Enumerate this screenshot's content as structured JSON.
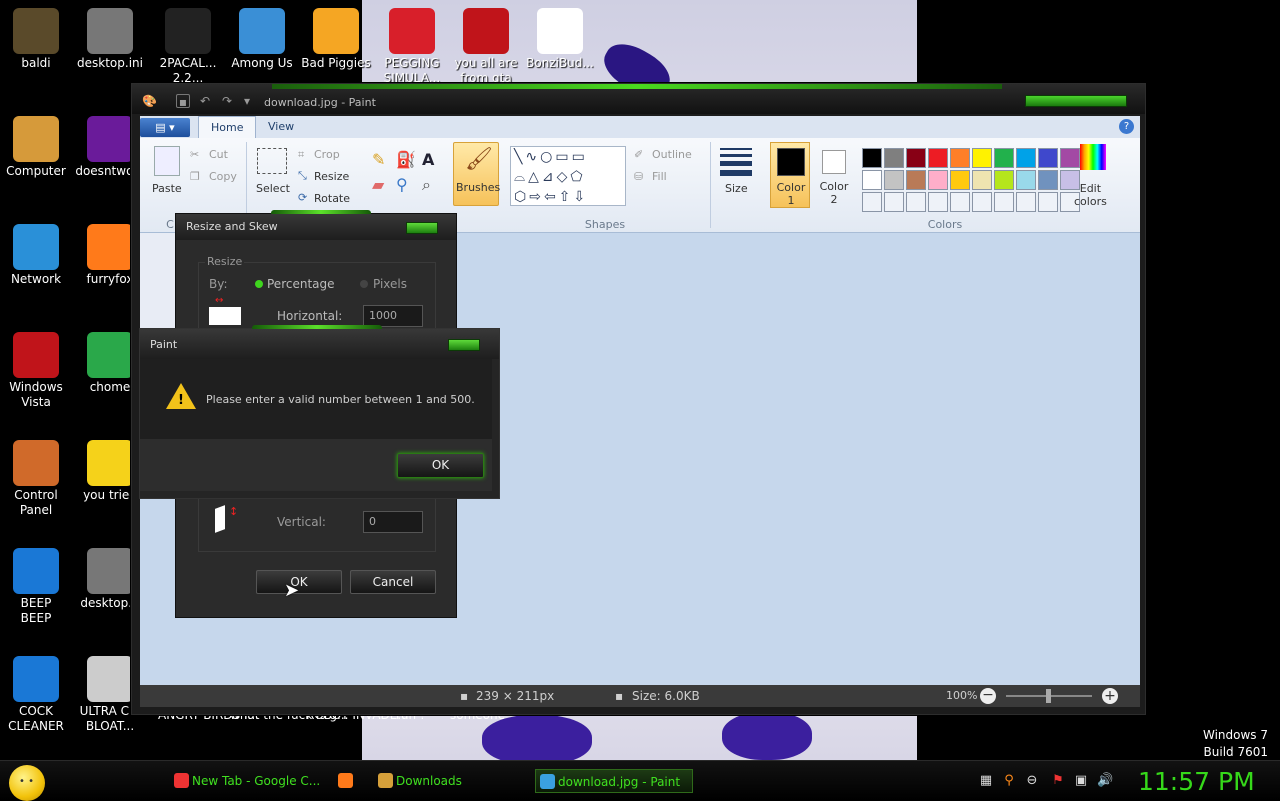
{
  "desktop": {
    "icons": [
      {
        "label": "baldi",
        "color": "#5a4a2a"
      },
      {
        "label": "desktop.ini",
        "color": "#777"
      },
      {
        "label": "2PACAL...\n2.2...",
        "color": "#222"
      },
      {
        "label": "Among Us",
        "color": "#3a8fd6"
      },
      {
        "label": "Bad Piggies",
        "color": "#f5a623"
      },
      {
        "label": "PEGGING\nSIMULA...",
        "color": "#d81f2a"
      },
      {
        "label": "you all are\nfrom gta",
        "color": "#c0141a"
      },
      {
        "label": "BonziBud...",
        "color": "#ffffff"
      },
      {
        "label": "Computer",
        "color": "#d69a3a"
      },
      {
        "label": "doesntwo...",
        "color": "#6a1b9a"
      },
      {
        "label": "Network",
        "color": "#2a90d8"
      },
      {
        "label": "furryfox",
        "color": "#ff7a1a"
      },
      {
        "label": "Windows\nVista",
        "color": "#c0141a"
      },
      {
        "label": "chome",
        "color": "#2aa84a"
      },
      {
        "label": "Control\nPanel",
        "color": "#d06a2a"
      },
      {
        "label": "you tried",
        "color": "#f5d21a"
      },
      {
        "label": "BEEP\nBEEP",
        "color": "#1a78d6"
      },
      {
        "label": "desktop...",
        "color": "#777"
      },
      {
        "label": "COCK\nCLEANER",
        "color": "#1a78d6"
      },
      {
        "label": "ULTRA C...\nBLOAT...",
        "color": "#cccccc"
      }
    ],
    "behind_labels": [
      "ANGRY\nBIRDS I...",
      "what the\nfuck is g...",
      "ROBOT\nINVADE...",
      "run !",
      "someone"
    ],
    "os_name": "Windows 7",
    "os_build": "Build 7601"
  },
  "paint": {
    "title": "download.jpg - Paint",
    "tabs": {
      "file": "▤ ▾",
      "home": "Home",
      "view": "View"
    },
    "ribbon": {
      "paste": "Paste",
      "cut": "Cut",
      "copy": "Copy",
      "select": "Select",
      "crop": "Crop",
      "resize": "Resize",
      "rotate": "Rotate",
      "brushes": "Brushes",
      "outline": "Outline",
      "fill": "Fill",
      "shapes_group": "Shapes",
      "size": "Size",
      "color1": "Color\n1",
      "color2": "Color\n2",
      "edit_colors": "Edit\ncolors",
      "colors_group": "Colors",
      "clip_group": "C"
    },
    "palette": [
      "#000000",
      "#7f7f7f",
      "#880015",
      "#ed1c24",
      "#ff7f27",
      "#fff200",
      "#22b14c",
      "#00a2e8",
      "#3f48cc",
      "#a349a4",
      "#ffffff",
      "#c3c3c3",
      "#b97a57",
      "#ffaec9",
      "#ffc90e",
      "#efe4b0",
      "#b5e61d",
      "#99d9ea",
      "#7092be",
      "#c8bfe7"
    ],
    "status": {
      "dims": "239 × 211px",
      "size": "Size: 6.0KB",
      "zoom": "100%"
    }
  },
  "resize_dialog": {
    "title": "Resize and Skew",
    "group": "Resize",
    "by": "By:",
    "percentage": "Percentage",
    "pixels": "Pixels",
    "horizontal": "Horizontal:",
    "horizontal_value": "1000",
    "vertical": "Vertical:",
    "vertical_value": "0",
    "ok": "OK",
    "cancel": "Cancel"
  },
  "alert": {
    "title": "Paint",
    "message": "Please enter a valid number between 1 and 500.",
    "ok": "OK"
  },
  "taskbar": {
    "tasks": [
      {
        "label": "New Tab - Google C...",
        "color": "#e33"
      },
      {
        "label": "",
        "color": "#ff7a1a"
      },
      {
        "label": "Downloads",
        "color": "#d6a03a"
      },
      {
        "label": "download.jpg - Paint",
        "color": "#3aa0e0"
      }
    ],
    "clock": "11:57 PM"
  }
}
